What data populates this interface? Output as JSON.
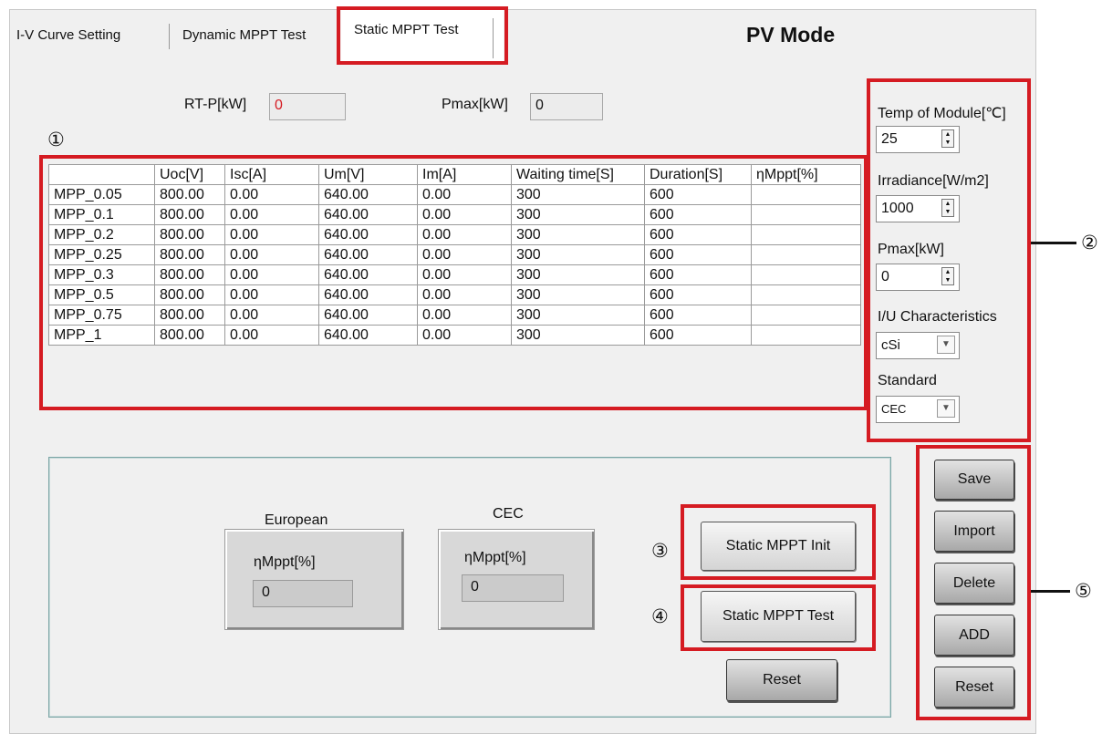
{
  "tabs": [
    "I-V Curve Setting",
    "Dynamic MPPT Test",
    "Static MPPT Test"
  ],
  "window_title": "PV Mode",
  "rt_p": {
    "label": "RT-P[kW]",
    "value": "0"
  },
  "pmax_top": {
    "label": "Pmax[kW]",
    "value": "0"
  },
  "annotations": [
    "①",
    "②",
    "③",
    "④",
    "⑤"
  ],
  "table": {
    "headers": [
      "",
      "Uoc[V]",
      "Isc[A]",
      "Um[V]",
      "Im[A]",
      "Waiting time[S]",
      "Duration[S]",
      "ηMppt[%]"
    ],
    "rows": [
      [
        "MPP_0.05",
        "800.00",
        "0.00",
        "640.00",
        "0.00",
        "300",
        "600",
        ""
      ],
      [
        "MPP_0.1",
        "800.00",
        "0.00",
        "640.00",
        "0.00",
        "300",
        "600",
        ""
      ],
      [
        "MPP_0.2",
        "800.00",
        "0.00",
        "640.00",
        "0.00",
        "300",
        "600",
        ""
      ],
      [
        "MPP_0.25",
        "800.00",
        "0.00",
        "640.00",
        "0.00",
        "300",
        "600",
        ""
      ],
      [
        "MPP_0.3",
        "800.00",
        "0.00",
        "640.00",
        "0.00",
        "300",
        "600",
        ""
      ],
      [
        "MPP_0.5",
        "800.00",
        "0.00",
        "640.00",
        "0.00",
        "300",
        "600",
        ""
      ],
      [
        "MPP_0.75",
        "800.00",
        "0.00",
        "640.00",
        "0.00",
        "300",
        "600",
        ""
      ],
      [
        "MPP_1",
        "800.00",
        "0.00",
        "640.00",
        "0.00",
        "300",
        "600",
        ""
      ]
    ]
  },
  "settings": {
    "temp": {
      "label": "Temp of Module[℃]",
      "value": "25"
    },
    "irradiance": {
      "label": "Irradiance[W/m2]",
      "value": "1000"
    },
    "pmax": {
      "label": "Pmax[kW]",
      "value": "0"
    },
    "iu": {
      "label": "I/U Characteristics",
      "value": "cSi"
    },
    "standard": {
      "label": "Standard",
      "value": "CEC"
    }
  },
  "results": {
    "european": {
      "title": "European",
      "label": "ηMppt[%]",
      "value": "0"
    },
    "cec": {
      "title": "CEC",
      "label": "ηMppt[%]",
      "value": "0"
    }
  },
  "buttons": {
    "init": "Static MPPT Init",
    "test": "Static MPPT Test",
    "reset_main": "Reset",
    "save": "Save",
    "import": "Import",
    "delete": "Delete",
    "add": "ADD",
    "reset_side": "Reset"
  },
  "colors": {
    "highlight": "#d51b22",
    "rtp_value": "#d51b22"
  }
}
